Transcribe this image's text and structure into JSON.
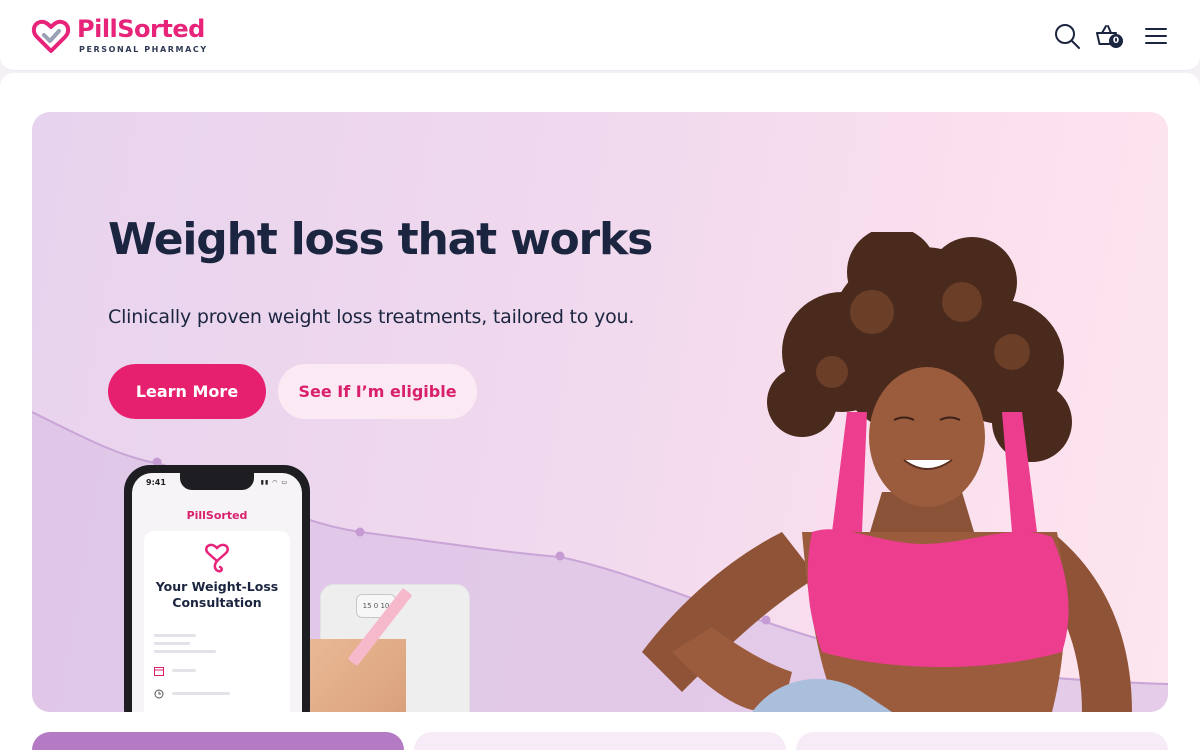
{
  "header": {
    "logo_name": "PillSorted",
    "logo_tagline": "PERSONAL PHARMACY",
    "cart_count": "0",
    "icons": [
      "search-icon",
      "basket-icon",
      "menu-icon"
    ]
  },
  "hero": {
    "title": "Weight loss that works",
    "subtitle": "Clinically proven weight loss treatments, tailored to you.",
    "primary_button": "Learn More",
    "secondary_button": "See If I’m eligible"
  },
  "phone": {
    "time": "9:41",
    "status": "▮▮ ◠ ▭",
    "brand": "PillSorted",
    "card_title_line1": "Your Weight-Loss",
    "card_title_line2": "Consultation"
  },
  "scale": {
    "dial": "15 0 10"
  },
  "colors": {
    "brand_pink": "#e8237a",
    "navy": "#1b2540",
    "hero_bg": "#f0d9ee",
    "secondary_button_bg": "#fbeaf3",
    "card_purple": "#b47ac4"
  }
}
